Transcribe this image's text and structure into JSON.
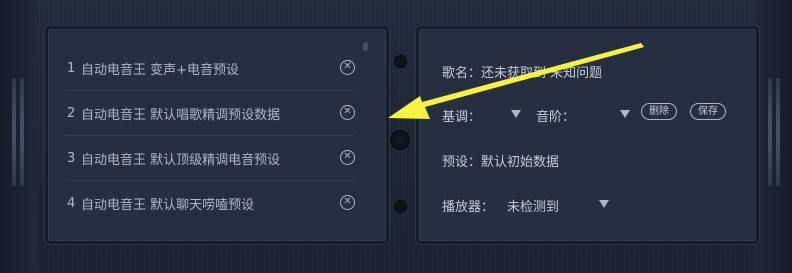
{
  "presets": [
    {
      "num": "1",
      "label": "自动电音王 变声+电音预设"
    },
    {
      "num": "2",
      "label": "自动电音王 默认唱歌精调预设数据"
    },
    {
      "num": "3",
      "label": "自动电音王 默认顶级精调电音预设"
    },
    {
      "num": "4",
      "label": "自动电音王 默认聊天唠嗑预设"
    }
  ],
  "song": {
    "label": "歌名：",
    "value": "还未获取到 未知问题"
  },
  "key": {
    "label": "基调："
  },
  "scale": {
    "label": "音阶："
  },
  "buttons": {
    "delete": "删除",
    "save": "保存"
  },
  "preset_info": {
    "label": "预设：",
    "value": "默认初始数据"
  },
  "player": {
    "label": "播放器：",
    "value": "未检测到"
  },
  "colors": {
    "annotation_arrow": "#f5f53a",
    "panel": "#262f40",
    "text": "#c6cdd8"
  }
}
